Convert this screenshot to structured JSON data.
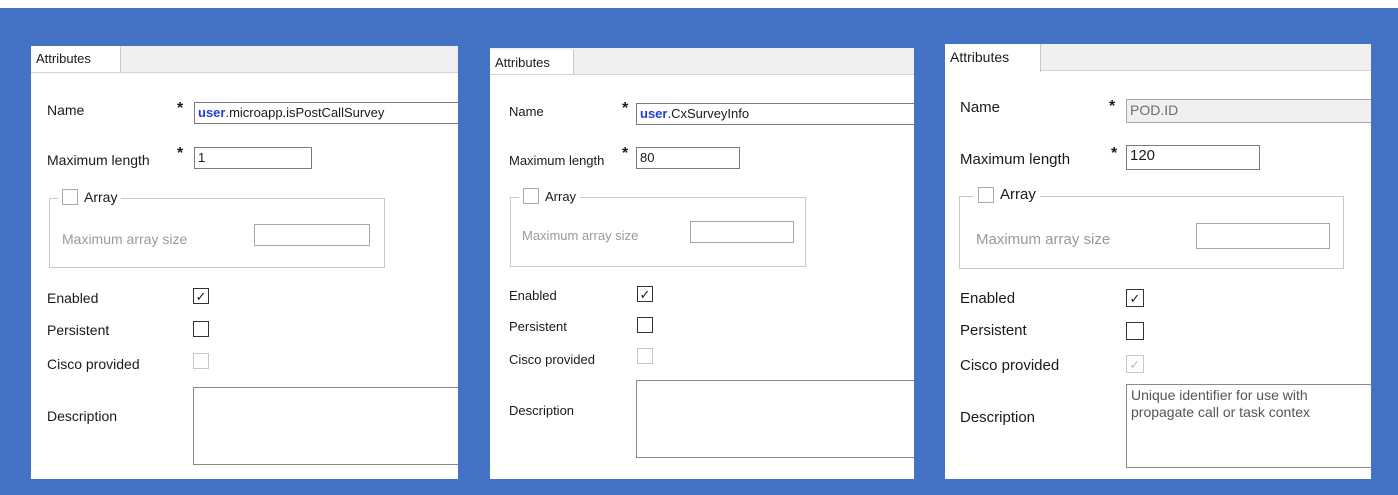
{
  "panels": [
    {
      "tab": "Attributes",
      "name_label": "Name",
      "name_prefix": "user",
      "name_value": ".microapp.isPostCallSurvey",
      "maxlen_label": "Maximum length",
      "maxlen_value": "1",
      "array_label": "Array",
      "array_size_label": "Maximum array size",
      "enabled_label": "Enabled",
      "persistent_label": "Persistent",
      "cisco_label": "Cisco provided",
      "description_label": "Description",
      "description_value": "",
      "enabled": true,
      "persistent": false,
      "cisco_provided": false
    },
    {
      "tab": "Attributes",
      "name_label": "Name",
      "name_prefix": "user",
      "name_value": ".CxSurveyInfo",
      "maxlen_label": "Maximum length",
      "maxlen_value": "80",
      "array_label": "Array",
      "array_size_label": "Maximum array size",
      "enabled_label": "Enabled",
      "persistent_label": "Persistent",
      "cisco_label": "Cisco provided",
      "description_label": "Description",
      "description_value": "",
      "enabled": true,
      "persistent": false,
      "cisco_provided": false
    },
    {
      "tab": "Attributes",
      "name_label": "Name",
      "name_prefix": "",
      "name_value": "POD.ID",
      "maxlen_label": "Maximum length",
      "maxlen_value": "120",
      "array_label": "Array",
      "array_size_label": "Maximum array size",
      "enabled_label": "Enabled",
      "persistent_label": "Persistent",
      "cisco_label": "Cisco provided",
      "description_label": "Description",
      "description_line1": "Unique identifier for use with",
      "description_line2": "propagate call or task contex",
      "enabled": true,
      "persistent": false,
      "cisco_provided": true
    }
  ],
  "required_marker": "*",
  "check_glyph": "✓",
  "colors": {
    "background": "#4472c4",
    "user_prefix": "#1f3fd6"
  }
}
